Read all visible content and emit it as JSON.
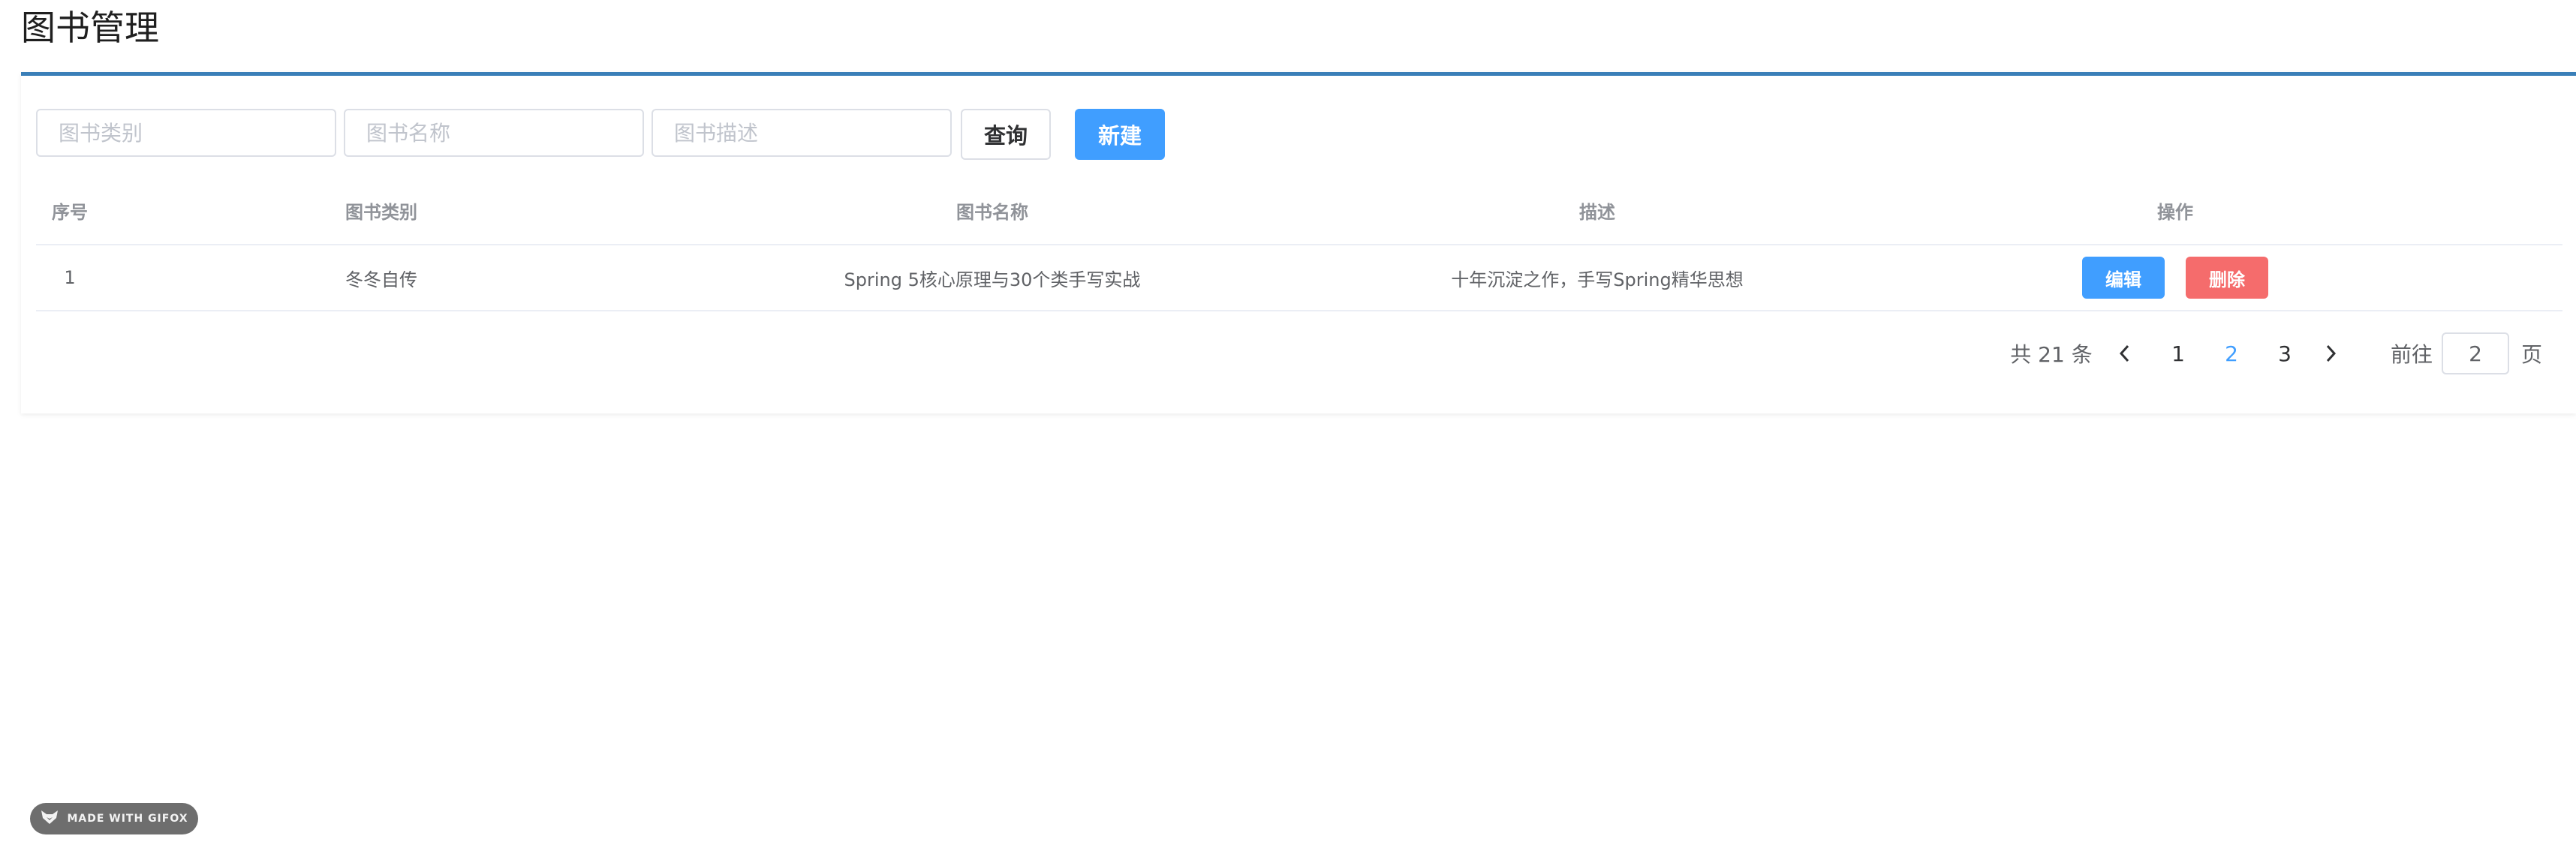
{
  "page": {
    "title": "图书管理"
  },
  "toolbar": {
    "category_placeholder": "图书类别",
    "name_placeholder": "图书名称",
    "desc_placeholder": "图书描述",
    "query_label": "查询",
    "new_label": "新建"
  },
  "table": {
    "headers": [
      "序号",
      "图书类别",
      "图书名称",
      "描述",
      "操作"
    ],
    "rows": [
      {
        "index": "1",
        "category": "冬冬自传",
        "name": "Spring 5核心原理与30个类手写实战",
        "description": "十年沉淀之作，手写Spring精华思想",
        "edit_label": "编辑",
        "delete_label": "删除"
      }
    ]
  },
  "pagination": {
    "total_text": "共 21 条",
    "pages": [
      "1",
      "2",
      "3"
    ],
    "current": "2",
    "goto_label": "前往",
    "goto_value": "2",
    "page_suffix": "页"
  },
  "watermark": {
    "text": "MADE WITH GIFOX",
    "icon": "fox-icon"
  },
  "colors": {
    "primary": "#409eff",
    "danger": "#f56c6c",
    "panel_border": "#3a7fb8"
  }
}
